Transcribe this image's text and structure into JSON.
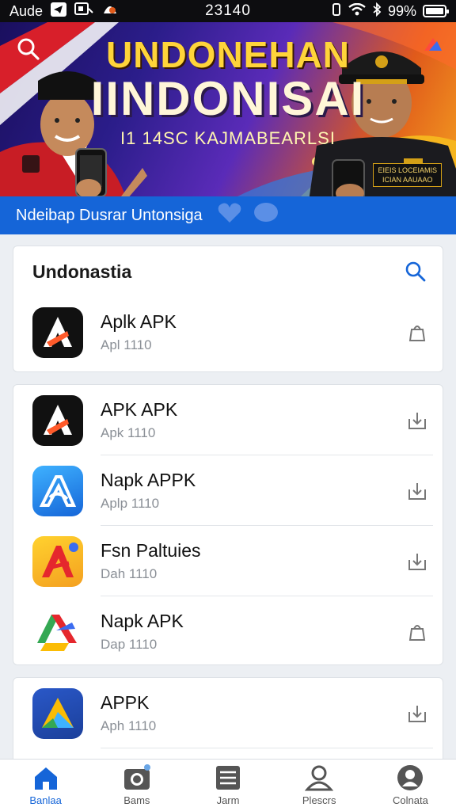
{
  "status_bar": {
    "carrier": "Aude",
    "time": "23140",
    "battery": "99%",
    "battery_level": 0.99
  },
  "banner": {
    "title_line1": "UNDONEHAN",
    "title_line2": "IINDONISAI",
    "subtitle": "I1 14SC KAJMABEARLSI",
    "badge_line1": "EIEIS LOCEIAMIS",
    "badge_line2": "ICIAN AAUAAO"
  },
  "ribbon": {
    "text": "Ndeibap Dusrar Untonsiga"
  },
  "section": {
    "title": "Undonastia"
  },
  "featured_apps": [
    {
      "name": "Aplk APK",
      "subtitle": "Apl 1110",
      "icon": "apk-logo-black-icon",
      "action": "bag-icon"
    }
  ],
  "apps": [
    {
      "name": "APK APK",
      "subtitle": "Apk 1110",
      "icon": "apk-logo-black-icon",
      "action": "download-icon"
    },
    {
      "name": "Napk APPK",
      "subtitle": "Aplp 1110",
      "icon": "apk-logo-blue-icon",
      "action": "download-icon"
    },
    {
      "name": "Fsn Paltuies",
      "subtitle": "Dah 1110",
      "icon": "apk-logo-yellow-icon",
      "action": "download-icon"
    },
    {
      "name": "Napk APK",
      "subtitle": "Dap 1110",
      "icon": "apk-logo-multicolor-icon",
      "action": "bag-icon"
    }
  ],
  "more_apps": [
    {
      "name": "APPK",
      "subtitle": "Aph 1110",
      "icon": "apk-logo-gradient-icon",
      "action": "download-icon"
    }
  ],
  "tab_bar": [
    {
      "label": "Banlaa",
      "icon": "home-icon",
      "active": true
    },
    {
      "label": "Bams",
      "icon": "camera-icon",
      "active": false
    },
    {
      "label": "Jarm",
      "icon": "list-icon",
      "active": false
    },
    {
      "label": "Plescrs",
      "icon": "person-icon",
      "active": false
    },
    {
      "label": "Colnata",
      "icon": "profile-icon",
      "active": false
    }
  ],
  "colors": {
    "accent": "#1565d8",
    "banner_title": "#ffd43a"
  }
}
